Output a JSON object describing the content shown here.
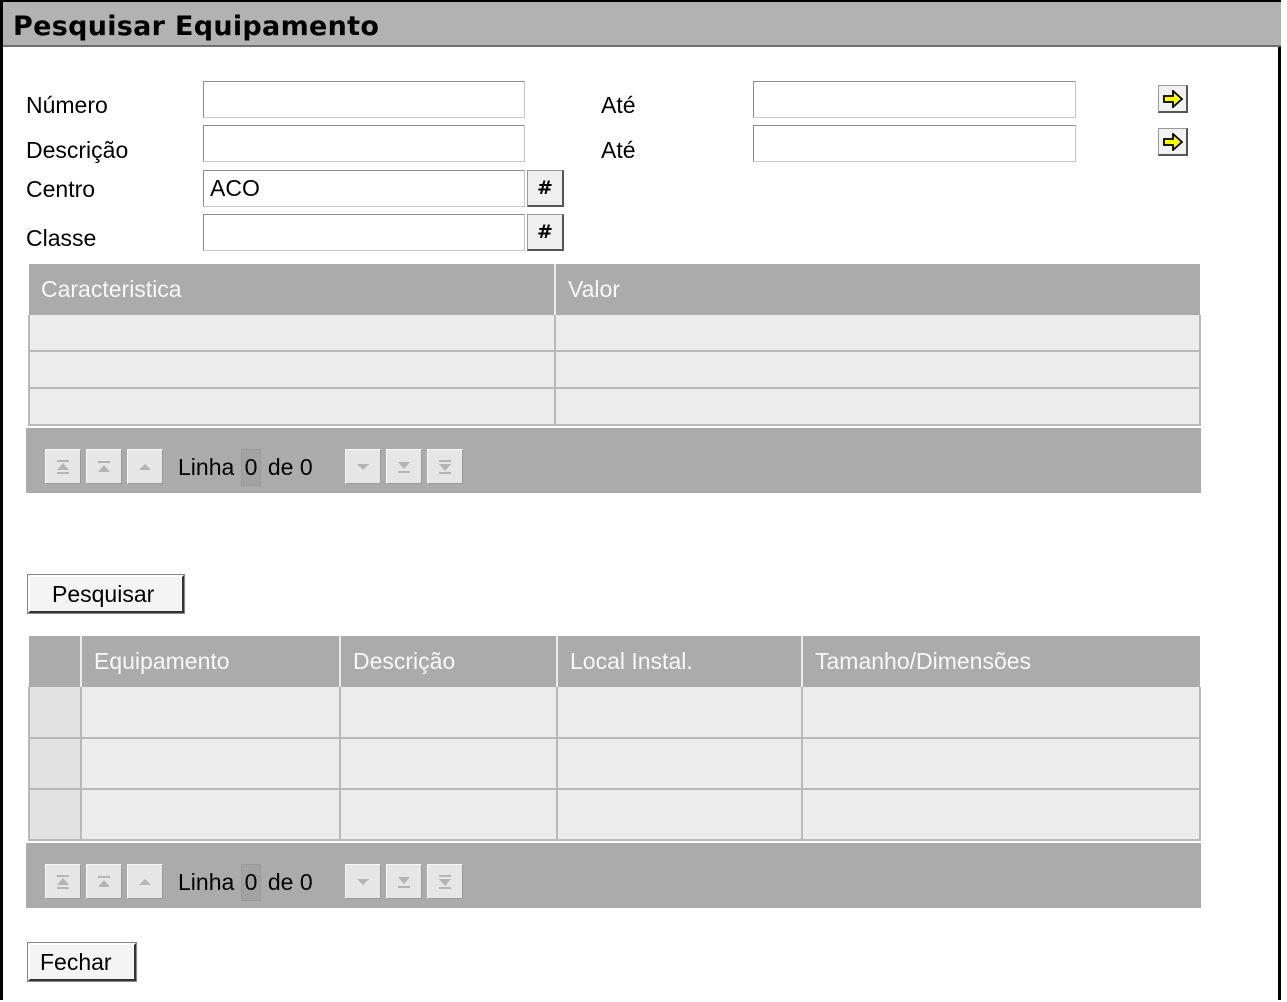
{
  "window": {
    "title": "Pesquisar Equipamento"
  },
  "form": {
    "numero_label": "Número",
    "descricao_label": "Descrição",
    "ate_label": "Até",
    "centro_label": "Centro",
    "centro_value": "ACO",
    "classe_label": "Classe",
    "hash_label": "#"
  },
  "char_table": {
    "columns": [
      "Caracteristica",
      "Valor"
    ],
    "nav": {
      "linha": "Linha",
      "current": "0",
      "de": "de 0"
    }
  },
  "search_button": "Pesquisar",
  "results_table": {
    "columns": [
      "Equipamento",
      "Descrição",
      "Local Instal.",
      "Tamanho/Dimensões"
    ],
    "nav": {
      "linha": "Linha",
      "current": "0",
      "de": "de 0"
    }
  },
  "close_button": "Fechar",
  "colors": {
    "header_bg": "#ababab",
    "row_bg": "#ececec",
    "arrow_yellow": "#ffff00"
  }
}
